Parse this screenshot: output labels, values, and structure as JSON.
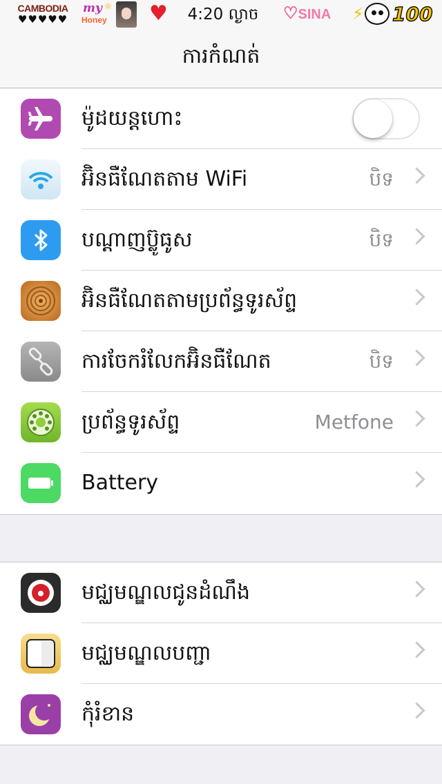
{
  "status_bar": {
    "carrier": "CAMBODIA",
    "carrier_hearts": "♥♥♥♥♥",
    "sticker_my": "my",
    "sticker_honey": "Honey",
    "time": "4:20 ល្ងាច",
    "sina": "SINA",
    "battery": "100"
  },
  "nav": {
    "title": "ការកំណត់"
  },
  "settings_group_1": [
    {
      "label": "ម៉ូដយន្តហោះ",
      "value": "",
      "icon": "airplane-icon",
      "color": "#b04ab0",
      "toggle": false
    },
    {
      "label": "អ៊ិនធឺណែតតាម WiFi",
      "value": "បិទ",
      "icon": "wifi-icon",
      "color": "#dfeff8"
    },
    {
      "label": "បណ្តាញប៊្លូធូស",
      "value": "បិទ",
      "icon": "bluetooth-icon",
      "color": "#2d9cf0"
    },
    {
      "label": "អ៊ិនធឺណែតតាមប្រព័ន្ធទូរស័ព្ទ",
      "value": "",
      "icon": "cellular-icon",
      "color": "#d6852a"
    },
    {
      "label": "ការចែករំលែកអ៊ិនធឺណែត",
      "value": "បិទ",
      "icon": "hotspot-link-icon",
      "color": "#9a9a9a"
    },
    {
      "label": "ប្រព័ន្ធទូរស័ព្ទ",
      "value": "Metfone",
      "icon": "carrier-phone-icon",
      "color": "#8fcf3a"
    },
    {
      "label": "Battery",
      "value": "",
      "icon": "battery-icon",
      "color": "#4cd964"
    }
  ],
  "settings_group_2": [
    {
      "label": "មជ្ឈមណ្ឌលជូនដំណឹង",
      "icon": "notification-center-icon",
      "color": "#2b2b2b"
    },
    {
      "label": "មជ្ឈមណ្ឌលបញ្ជា",
      "icon": "control-center-icon",
      "color": "#f3d27a"
    },
    {
      "label": "កុំរំខាន",
      "icon": "moon-icon",
      "color": "#9b3fa8"
    }
  ]
}
